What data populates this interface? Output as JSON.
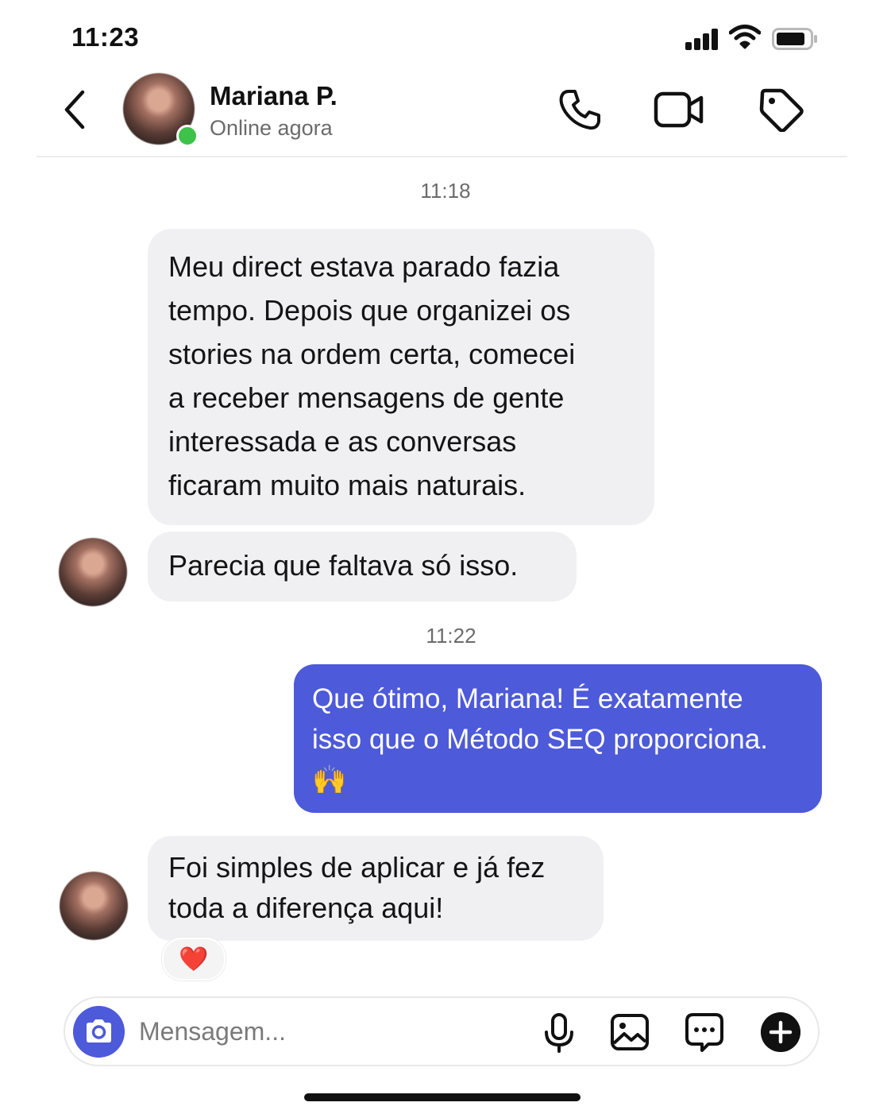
{
  "status_bar": {
    "time": "11:23",
    "icons": [
      "signal-icon",
      "wifi-icon",
      "battery-icon"
    ]
  },
  "header": {
    "contact_name": "Mariana P.",
    "contact_status": "Online agora",
    "online_indicator_color": "#3ec24a",
    "actions": [
      "back-icon",
      "phone-icon",
      "video-call-icon",
      "tag-icon"
    ]
  },
  "conversation": {
    "timestamp_1": "11:18",
    "incoming_1": {
      "lines": [
        "Meu direct estava parado fazia",
        "tempo. Depois que organizei os",
        "stories na ordem certa, comecei",
        "a receber mensagens de gente",
        "interessada e as conversas",
        "ficaram muito mais naturais."
      ]
    },
    "incoming_2": {
      "text": "Parecia que faltava só isso."
    },
    "timestamp_2": "11:22",
    "outgoing_1": {
      "lines": [
        "Que ótimo, Mariana! É exatamente",
        "isso que o Método SEQ proporciona.",
        "🙌"
      ]
    },
    "incoming_3": {
      "lines": [
        "Foi simples de aplicar e já fez",
        "toda a diferença aqui!"
      ],
      "reaction": "❤️"
    }
  },
  "composer": {
    "placeholder": "Mensagem...",
    "value": "",
    "icons": [
      "camera-icon",
      "microphone-icon",
      "gallery-icon",
      "sticker-chat-icon",
      "plus-icon"
    ]
  },
  "colors": {
    "accent": "#4d5ad9",
    "incoming_bubble": "#f0f0f2",
    "online": "#3ec24a"
  }
}
